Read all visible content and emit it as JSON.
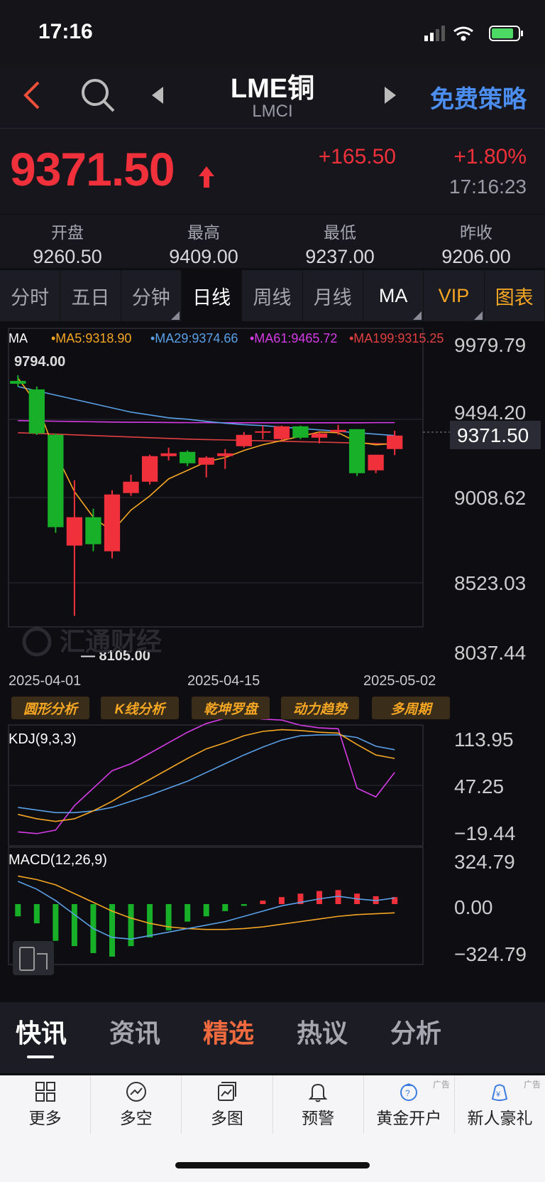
{
  "status_bar": {
    "time": "17:16"
  },
  "nav": {
    "title": "LME铜",
    "subtitle": "LMCI",
    "strategy": "免费策略"
  },
  "quote": {
    "price": "9371.50",
    "change": "+165.50",
    "change_pct": "+1.80%",
    "time": "17:16:23",
    "up_color": "#f0303a"
  },
  "stats": [
    {
      "label": "开盘",
      "value": "9260.50"
    },
    {
      "label": "最高",
      "value": "9409.00"
    },
    {
      "label": "最低",
      "value": "9237.00"
    },
    {
      "label": "昨收",
      "value": "9206.00"
    }
  ],
  "tabs": [
    {
      "label": "分时"
    },
    {
      "label": "五日"
    },
    {
      "label": "分钟"
    },
    {
      "label": "日线"
    },
    {
      "label": "周线"
    },
    {
      "label": "月线"
    },
    {
      "label": "MA"
    },
    {
      "label": "VIP"
    },
    {
      "label": "图表"
    }
  ],
  "active_tab": "日线",
  "ma_legend": {
    "prefix": "MA",
    "ma5": "•MA5:9318.90",
    "ma29": "•MA29:9374.66",
    "ma61": "•MA61:9465.72",
    "ma199": "•MA199:9315.25"
  },
  "price_axis": [
    "9979.79",
    "9494.20",
    "9008.62",
    "8523.03",
    "8037.44"
  ],
  "current_price_label": "9371.50",
  "high_marker": "9794.00",
  "low_marker": "— 8105.00",
  "watermark": "汇通财经",
  "date_axis": [
    "2025-04-01",
    "2025-04-15",
    "2025-05-02"
  ],
  "tool_buttons": [
    "圆形分析",
    "K线分析",
    "乾坤罗盘",
    "动力趋势",
    "多周期"
  ],
  "kdj": {
    "label": "KDJ(9,3,3)",
    "axis": [
      "113.95",
      "47.25",
      "−19.44"
    ]
  },
  "macd": {
    "label": "MACD(12,26,9)",
    "axis": [
      "324.79",
      "0.00",
      "−324.79"
    ]
  },
  "news_tabs": [
    {
      "label": "快讯",
      "active": true
    },
    {
      "label": "资讯",
      "active": false
    },
    {
      "label": "精选",
      "highlight": true
    },
    {
      "label": "热议",
      "active": false
    },
    {
      "label": "分析",
      "active": false
    }
  ],
  "bottom_bar": [
    {
      "label": "更多",
      "icon": "grid-icon"
    },
    {
      "label": "多空",
      "icon": "trend-icon"
    },
    {
      "label": "多图",
      "icon": "multi-chart-icon"
    },
    {
      "label": "预警",
      "icon": "bell-icon"
    },
    {
      "label": "黄金开户",
      "icon": "gold-account-icon",
      "ad": "广告"
    },
    {
      "label": "新人豪礼",
      "icon": "gift-icon",
      "ad": "广告"
    }
  ],
  "chart_data": {
    "type": "candlestick",
    "ylim": [
      8037.44,
      9979.79
    ],
    "candles": [
      {
        "o": 9760,
        "c": 9740,
        "h": 9800,
        "l": 9720
      },
      {
        "o": 9700,
        "c": 9390,
        "h": 9720,
        "l": 9380
      },
      {
        "o": 9380,
        "c": 8730,
        "h": 9390,
        "l": 8690
      },
      {
        "o": 8600,
        "c": 8800,
        "h": 9060,
        "l": 8105
      },
      {
        "o": 8800,
        "c": 8610,
        "h": 8860,
        "l": 8560
      },
      {
        "o": 8560,
        "c": 8960,
        "h": 8990,
        "l": 8510
      },
      {
        "o": 8970,
        "c": 9050,
        "h": 9100,
        "l": 8950
      },
      {
        "o": 9050,
        "c": 9230,
        "h": 9240,
        "l": 9030
      },
      {
        "o": 9230,
        "c": 9250,
        "h": 9290,
        "l": 9200
      },
      {
        "o": 9260,
        "c": 9180,
        "h": 9270,
        "l": 9160
      },
      {
        "o": 9170,
        "c": 9220,
        "h": 9230,
        "l": 9080
      },
      {
        "o": 9230,
        "c": 9250,
        "h": 9280,
        "l": 9140
      },
      {
        "o": 9300,
        "c": 9380,
        "h": 9400,
        "l": 9290
      },
      {
        "o": 9395,
        "c": 9405,
        "h": 9445,
        "l": 9350
      },
      {
        "o": 9350,
        "c": 9440,
        "h": 9445,
        "l": 9340
      },
      {
        "o": 9440,
        "c": 9360,
        "h": 9445,
        "l": 9350
      },
      {
        "o": 9360,
        "c": 9390,
        "h": 9400,
        "l": 9320
      },
      {
        "o": 9400,
        "c": 9415,
        "h": 9450,
        "l": 9380
      },
      {
        "o": 9420,
        "c": 9110,
        "h": 9420,
        "l": 9090
      },
      {
        "o": 9130,
        "c": 9240,
        "h": 9240,
        "l": 9110
      },
      {
        "o": 9280,
        "c": 9375,
        "h": 9409,
        "l": 9237
      }
    ],
    "ma5": [
      9780,
      9600,
      9250,
      8980,
      8800,
      8700,
      8850,
      8950,
      9070,
      9130,
      9190,
      9220,
      9270,
      9310,
      9340,
      9370,
      9400,
      9395,
      9330,
      9310,
      9319
    ],
    "ma29": [
      9720,
      9690,
      9660,
      9630,
      9600,
      9570,
      9540,
      9520,
      9500,
      9490,
      9475,
      9462,
      9452,
      9445,
      9435,
      9425,
      9415,
      9405,
      9395,
      9385,
      9375
    ],
    "ma61": [
      9480,
      9478,
      9476,
      9474,
      9472,
      9470,
      9469,
      9468,
      9467,
      9466,
      9466,
      9465,
      9465,
      9465,
      9465,
      9465,
      9465,
      9465,
      9465,
      9466,
      9466
    ],
    "ma199": [
      9395,
      9390,
      9385,
      9380,
      9375,
      9370,
      9365,
      9360,
      9355,
      9350,
      9347,
      9344,
      9341,
      9338,
      9335,
      9332,
      9329,
      9326,
      9322,
      9318,
      9315
    ],
    "kdj_range": [
      -19.44,
      113.95
    ],
    "kdj_k": [
      10,
      5,
      2,
      5,
      14,
      25,
      38,
      50,
      62,
      74,
      85,
      92,
      100,
      105,
      107,
      106,
      104,
      103,
      90,
      78,
      74
    ],
    "kdj_d": [
      18,
      15,
      12,
      12,
      14,
      18,
      25,
      32,
      40,
      48,
      58,
      68,
      78,
      87,
      95,
      100,
      101,
      101,
      98,
      88,
      84
    ],
    "kdj_j": [
      -10,
      -12,
      -8,
      20,
      40,
      60,
      68,
      80,
      92,
      104,
      114,
      120,
      122,
      119,
      118,
      112,
      109,
      108,
      40,
      30,
      58
    ],
    "macd_range": [
      -324.79,
      324.79
    ],
    "macd_dif": [
      130,
      85,
      20,
      -60,
      -140,
      -190,
      -200,
      -180,
      -160,
      -140,
      -120,
      -100,
      -70,
      -40,
      -10,
      10,
      30,
      45,
      30,
      20,
      35
    ],
    "macd_dea": [
      160,
      140,
      110,
      60,
      10,
      -40,
      -80,
      -110,
      -130,
      -140,
      -145,
      -145,
      -140,
      -130,
      -115,
      -100,
      -85,
      -70,
      -60,
      -55,
      -50
    ],
    "macd_hist": [
      -70,
      -110,
      -210,
      -240,
      -280,
      -300,
      -240,
      -190,
      -150,
      -100,
      -70,
      -40,
      -10,
      20,
      40,
      60,
      75,
      80,
      60,
      45,
      40
    ]
  }
}
